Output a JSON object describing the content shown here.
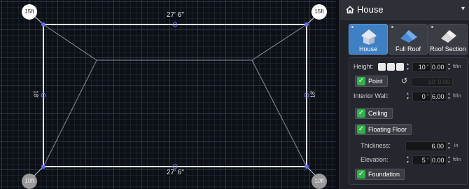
{
  "canvas": {
    "corner_top_left": "15ft",
    "corner_top_right": "15ft",
    "corner_bottom_left": "10ft",
    "corner_bottom_right": "10ft",
    "dim_top": "27' 6\"",
    "dim_bottom": "27' 6\"",
    "dim_left": "18'",
    "dim_right": "18'"
  },
  "panel": {
    "title": "House",
    "tabs": [
      {
        "label": "House",
        "active": true
      },
      {
        "label": "Full Roof",
        "active": false
      },
      {
        "label": "Roof Section",
        "active": false
      }
    ],
    "height_label": "Height:",
    "height_ft": "10 '",
    "height_in": "0.00",
    "height_unit": "ft/in",
    "point_label": "Point",
    "point_value": "10' 0.00",
    "interior_wall_label": "Interior Wall:",
    "interior_wall_ft": "0 '",
    "interior_wall_in": "6.00",
    "interior_wall_unit": "ft/in",
    "ceiling_label": "Ceiling",
    "floating_floor_label": "Floating Floor",
    "thickness_label": "Thickness:",
    "thickness_value": "6.00",
    "thickness_unit": "in",
    "elevation_label": "Elevation:",
    "elevation_ft": "5 '",
    "elevation_in": "0.00",
    "elevation_unit": "ft/in",
    "foundation_label": "Foundation"
  },
  "colors": {
    "accent": "#3f7fc4",
    "check": "#2fb34a",
    "canvas_bg": "#0d1017",
    "vertex": "#6a6cf0"
  }
}
